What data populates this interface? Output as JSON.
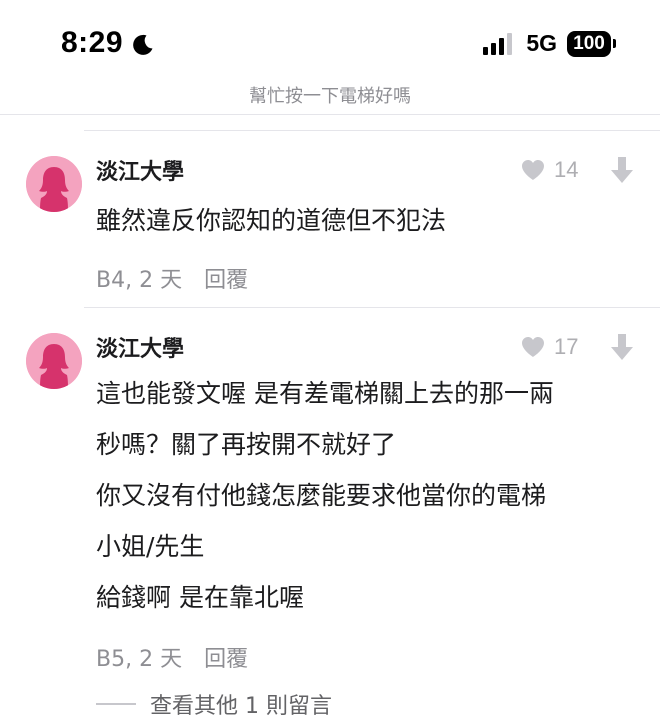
{
  "status_bar": {
    "time": "8:29",
    "time_icon": "moon-icon",
    "signal_icon": "cellular-signal-icon",
    "network": "5G",
    "battery": "100"
  },
  "header": {
    "title": "幫忙按一下電梯好嗎"
  },
  "comments": [
    {
      "author": "淡江大學",
      "avatar_icon": "anonymous-female-avatar",
      "likes": "14",
      "lines": [
        "雖然違反你認知的道德但不犯法"
      ],
      "floor_time": "B4, 2 天",
      "reply_label": "回覆"
    },
    {
      "author": "淡江大學",
      "avatar_icon": "anonymous-female-avatar",
      "likes": "17",
      "lines": [
        "這也能發文喔 是有差電梯關上去的那一兩",
        "秒嗎？關了再按開不就好了",
        "你又沒有付他錢怎麼能要求他當你的電梯",
        "小姐/先生",
        "給錢啊 是在靠北喔"
      ],
      "floor_time": "B5, 2 天",
      "reply_label": "回覆"
    }
  ],
  "more_replies": {
    "label": "查看其他 1 則留言"
  },
  "colors": {
    "avatar_bg": "#f4a3bf",
    "avatar_silhouette": "#d6336c",
    "muted_text": "#8e8e93",
    "icon_gray": "#c7c7cc"
  }
}
